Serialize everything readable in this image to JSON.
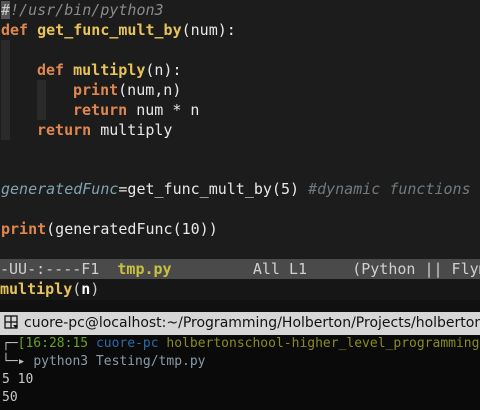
{
  "editor": {
    "shebang_hash": "#",
    "shebang_rest": "!/usr/bin/python3",
    "line2": {
      "kw": "def",
      "fn": "get_func_mult_by",
      "rest": "(num):"
    },
    "line4": {
      "kw": "def",
      "fn": "multiply",
      "rest": "(n):"
    },
    "line5": {
      "kw": "print",
      "rest": "(num,n)"
    },
    "line6": {
      "kw": "return",
      "rest": " num * n"
    },
    "line7": {
      "kw": "return",
      "rest": " multiply"
    },
    "line10": {
      "var": "generatedFunc",
      "rest": "=get_func_mult_by(5) ",
      "comment": "#dynamic functions"
    },
    "line12": {
      "kw": "print",
      "rest": "(generatedFunc(10))"
    }
  },
  "modeline": {
    "status": "-UU-:----F1  ",
    "filename": "tmp.py",
    "position": "         All L1     ",
    "mode": "(Python || Flym"
  },
  "minibuffer": {
    "fn": "multiply",
    "open": "(",
    "arg": "n",
    "close": ")"
  },
  "terminal": {
    "title": "cuore-pc@localhost:~/Programming/Holberton/Projects/holbertonschool-higher_level_programming",
    "prompt_time": "[16:28:15",
    "prompt_user": "cuore-pc",
    "prompt_dir": "holbertonschool-higher_level_programming",
    "command": "python3 Testing/tmp.py",
    "output": [
      "5 10",
      "50"
    ]
  }
}
